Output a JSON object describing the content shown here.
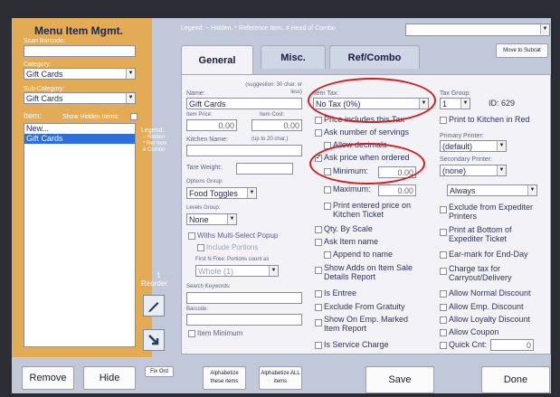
{
  "window": {
    "title": "Menu Item Mgmt.",
    "legend_text": "Legend: ~ Hidden, * Reference Item, # Head of Combo"
  },
  "sidebar": {
    "scan_label": "Scan Barcode:",
    "category_label": "Category:",
    "category_value": "Gift Cards",
    "subcategory_label": "Sub-Category:",
    "subcategory_value": "Gift Cards",
    "item_label": "Item:",
    "show_hidden_label": "Show Hidden Items:",
    "items": [
      "New...",
      "Gift Cards"
    ],
    "legend_lines": [
      "Legend:",
      "~ Hidden",
      "* Ref Item",
      "# Combo"
    ],
    "reorder_number": "1",
    "reorder_label": "Reorder",
    "edit_icon": "pencil-icon",
    "move_icon": "arrow-down-right-icon"
  },
  "top": {
    "move_button": "Move to Subcat"
  },
  "tabs": [
    {
      "label": "General",
      "active": true
    },
    {
      "label": "Misc.",
      "active": false
    },
    {
      "label": "Ref/Combo",
      "active": false
    }
  ],
  "general": {
    "name_label": "Name:",
    "name_hint": "(suggestion: 30 char. or less)",
    "name_value": "Gift Cards",
    "price_label": "Item Price:",
    "price_value": "0.00",
    "cost_label": "Item Cost:",
    "cost_value": "0.00",
    "kitchen_label": "Kitchen Name:",
    "kitchen_hint": "(up to 20 char.)",
    "tare_label": "Tare Weight:",
    "options_label": "Options Group:",
    "options_value": "Food Toggles",
    "levels_label": "Levels Group:",
    "levels_value": "None",
    "multi_select": "Withs Multi-Select Popup",
    "include_portions": "Include Portions",
    "first_n_label": "First N Free: Portions count as",
    "first_n_value": "Whole (1)",
    "search_label": "Search Keywords:",
    "barcode_label": "Barcode:",
    "item_minimum": "Item Minimum"
  },
  "tax": {
    "item_tax_label": "Item Tax:",
    "item_tax_value": "No Tax (0%)",
    "price_includes_tax": "Price includes this Tax",
    "ask_servings": "Ask number of servings",
    "allow_decimals": "Allow decimals",
    "ask_price": "Ask price when ordered",
    "minimum_label": "Minimum:",
    "minimum_value": "0.00",
    "maximum_label": "Maximum:",
    "maximum_value": "0.00",
    "print_price": "Print entered price on Kitchen Ticket",
    "qty_by_scale": "Qty. By Scale",
    "ask_item_name": "Ask Item name",
    "append_name": "Append to name",
    "show_adds": "Show Adds on Item Sale Details Report",
    "is_entree": "Is Entree",
    "exclude_gratuity": "Exclude From Gratuity",
    "show_emp_marked": "Show On Emp. Marked Item Report",
    "is_service_charge": "Is Service Charge"
  },
  "right": {
    "tax_group_label": "Tax Group:",
    "tax_group_value": "1",
    "id_text": "ID: 629",
    "print_kitchen_red": "Print to Kitchen in Red",
    "primary_printer_label": "Primary Printer:",
    "primary_printer_value": "(default)",
    "secondary_printer_label": "Secondary Printer:",
    "secondary_printer_value": "(none)",
    "always_value": "Always",
    "exclude_expediter": "Exclude from Expediter Printers",
    "print_bottom": "Print at Bottom of Expediter Ticket",
    "earmark": "Ear-mark for End-Day",
    "charge_tax": "Charge tax for Carryout/Delivery",
    "allow_normal": "Allow Normal Discount",
    "allow_emp": "Allow Emp. Discount",
    "allow_loyalty": "Allow Loyalty Discount",
    "allow_coupon": "Allow Coupon",
    "quick_cnt_label": "Quick Cnt:",
    "quick_cnt_value": "0"
  },
  "bottom": {
    "remove": "Remove",
    "hide": "Hide",
    "fix_ord": "Fix Ord",
    "alpha_these": "Alphabetize these items",
    "alpha_all": "Alphabetize ALL items",
    "save": "Save",
    "done": "Done"
  }
}
